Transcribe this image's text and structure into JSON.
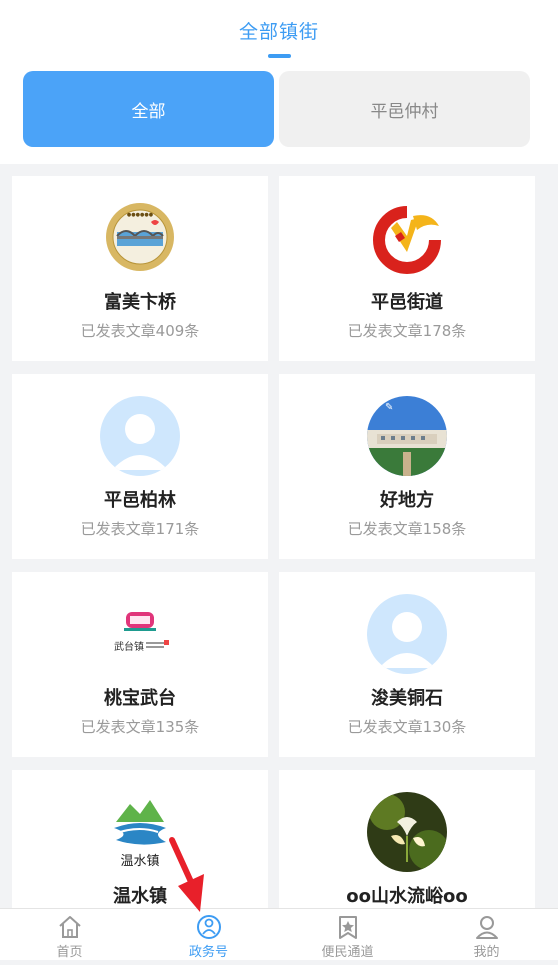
{
  "header": {
    "title": "全部镇街",
    "segments": [
      {
        "label": "全部",
        "selected": true
      },
      {
        "label": "平邑仲村",
        "selected": false
      }
    ]
  },
  "cards": [
    {
      "name": "富美卞桥",
      "count": "已发表文章409条",
      "icon": "bianqiao-badge-logo"
    },
    {
      "name": "平邑街道",
      "count": "已发表文章178条",
      "icon": "party-emblem-logo"
    },
    {
      "name": "平邑柏林",
      "count": "已发表文章171条",
      "icon": "default-avatar"
    },
    {
      "name": "好地方",
      "count": "已发表文章158条",
      "icon": "building-photo-logo"
    },
    {
      "name": "桃宝武台",
      "count": "已发表文章135条",
      "icon": "wutai-logo"
    },
    {
      "name": "浚美铜石",
      "count": "已发表文章130条",
      "icon": "default-avatar"
    },
    {
      "name": "温水镇",
      "count": "",
      "icon": "wenshui-logo",
      "logo_text": "温水镇"
    },
    {
      "name": "oo山水流峪oo",
      "count": "",
      "icon": "flower-photo-logo"
    }
  ],
  "tabbar": [
    {
      "label": "首页",
      "icon": "home-icon",
      "active": false
    },
    {
      "label": "政务号",
      "icon": "govt-account-icon",
      "active": true
    },
    {
      "label": "便民通道",
      "icon": "star-bookmark-icon",
      "active": false
    },
    {
      "label": "我的",
      "icon": "user-icon",
      "active": false
    }
  ],
  "colors": {
    "accent": "#3d9cf3",
    "segment_active": "#4ba3f8",
    "arrow": "#e8202a"
  }
}
